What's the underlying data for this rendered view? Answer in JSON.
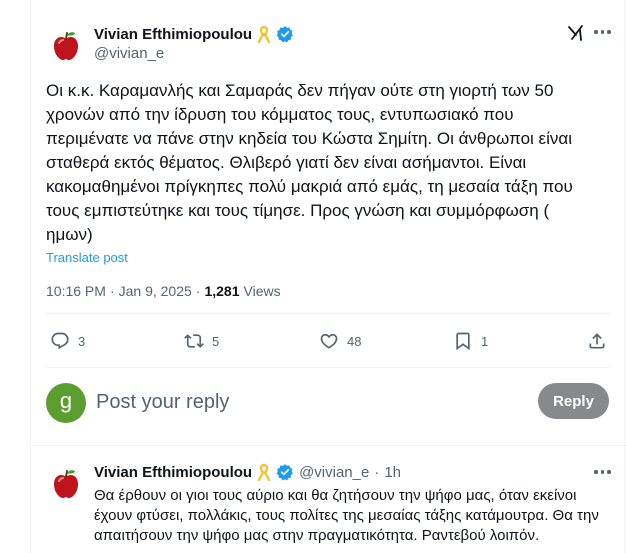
{
  "main_tweet": {
    "author_name": "Vivian Efthimiopoulou",
    "handle": "@vivian_e",
    "text": "Οι κ.κ. Καραμανλής και Σαμαράς δεν πήγαν ούτε στη γιορτή των 50 χρονών από την ίδρυση του κόμματος τους, εντυπωσιακό που περιμένατε να πάνε στην κηδεία του Κώστα Σημίτη. Οι άνθρωποι είναι σταθερά εκτός θέματος. Θλιβερό γιατί δεν είναι ασήμαντοι. Είναι κακομαθημένοι πρίγκηπες πολύ μακριά από εμάς, τη μεσαία τάξη που τους εμπιστεύτηκε και τους τίμησε. Προς γνώση και συμμόρφωση ( ημων)",
    "translate_label": "Translate post",
    "time": "10:16 PM",
    "date": "Jan 9, 2025",
    "separator": "·",
    "views_count": "1,281",
    "views_label": "Views",
    "actions": {
      "replies": "3",
      "reposts": "5",
      "likes": "48",
      "bookmarks": "1"
    },
    "icons": [
      "apple-avatar",
      "yellow-ribbon-icon",
      "verified-badge-icon",
      "grok-icon",
      "more-icon"
    ]
  },
  "reply_box": {
    "avatar_letter": "g",
    "placeholder": "Post your reply",
    "reply_button": "Reply"
  },
  "reply_tweet": {
    "author_name": "Vivian Efthimiopoulou",
    "handle": "@vivian_e",
    "separator": "·",
    "time_ago": "1h",
    "text": "Θα έρθουν οι γιοι τους αύριο και θα ζητήσουν την ψήφο μας, όταν εκείνοι έχουν φτύσει, πολλάκις, τους πολίτες της μεσαίας τάξης κατάμουτρα. Θα την απαιτήσουν την ψήφο μας  στην πραγματικότητα. Ραντεβού λοιπόν."
  },
  "colors": {
    "accent": "#1d9bf0",
    "verified": "#1d9bf0",
    "muted": "#536471",
    "reply_button_bg": "#87898c",
    "avatar_g_bg": "#5b9e2f",
    "ribbon": "#f4c430"
  }
}
